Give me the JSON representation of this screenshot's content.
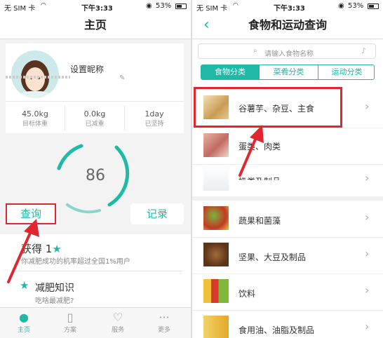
{
  "left": {
    "status": {
      "carrier": "无 SIM 卡",
      "time": "下午3:33",
      "battery": "53%"
    },
    "nav_title": "主页",
    "profile": {
      "nickname": "设置昵称"
    },
    "stats": [
      {
        "value": "45.0kg",
        "label": "目标体重"
      },
      {
        "value": "0.0kg",
        "label": "已减重"
      },
      {
        "value": "1day",
        "label": "已坚持"
      }
    ],
    "gauge_value": "86",
    "buttons": {
      "query": "查询",
      "record": "记录"
    },
    "cards": [
      {
        "title": "获得 1",
        "subtitle": "你减肥成功的机率超过全国1%用户"
      },
      {
        "title": "减肥知识",
        "subtitle": "吃啥最减肥?"
      }
    ],
    "tabbar": [
      {
        "label": "主页",
        "icon": "person-icon",
        "active": true
      },
      {
        "label": "方案",
        "icon": "document-icon",
        "active": false
      },
      {
        "label": "服务",
        "icon": "heart-icon",
        "active": false
      },
      {
        "label": "更多",
        "icon": "more-dots-icon",
        "active": false
      }
    ],
    "accent_color": "#1fb9a6",
    "annotation_color": "#e0262f"
  },
  "right": {
    "status": {
      "carrier": "无 SIM 卡",
      "time": "下午3:33",
      "battery": "53%"
    },
    "nav_title": "食物和运动查询",
    "search_placeholder": "请输入食物名称",
    "tabs": [
      {
        "label": "食物分类",
        "active": true
      },
      {
        "label": "菜肴分类",
        "active": false
      },
      {
        "label": "运动分类",
        "active": false
      }
    ],
    "list": [
      {
        "label": "谷薯芋、杂豆、主食",
        "icon": "grain-food-icon"
      },
      {
        "label": "蛋类、肉类",
        "icon": "meat-egg-icon"
      },
      {
        "label": "奶类及制品",
        "icon": "milk-icon"
      },
      {
        "label": "蔬果和菌藻",
        "icon": "vegetable-fruit-icon"
      },
      {
        "label": "坚果、大豆及制品",
        "icon": "nut-icon"
      },
      {
        "label": "饮料",
        "icon": "drink-icon"
      },
      {
        "label": "食用油、油脂及制品",
        "icon": "oil-icon"
      }
    ]
  }
}
